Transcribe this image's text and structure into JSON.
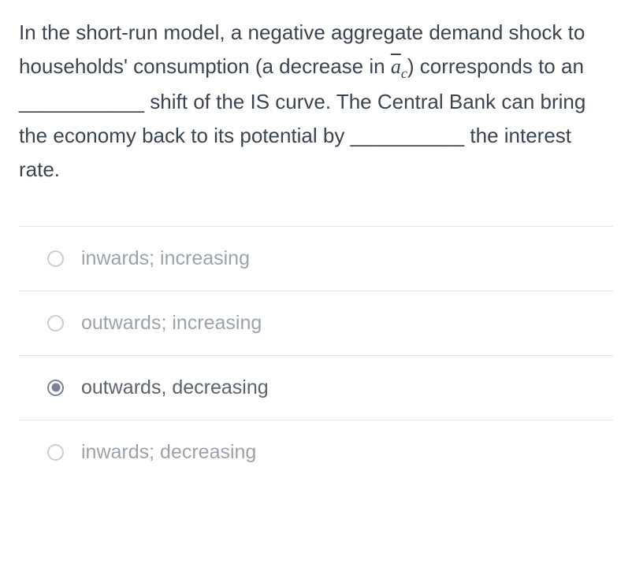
{
  "question": {
    "line1_prefix": "In the short-run model, a negative aggregate demand shock to households' consumption (a decrease in ",
    "variable_base": "a",
    "variable_sub": "c",
    "line1_suffix": ") corresponds to an ___________ shift of the IS curve. The Central Bank can bring the economy back to its potential by __________ the interest rate."
  },
  "options": [
    {
      "label": "inwards; increasing",
      "selected": false
    },
    {
      "label": "outwards; increasing",
      "selected": false
    },
    {
      "label": "outwards, decreasing",
      "selected": true
    },
    {
      "label": "inwards; decreasing",
      "selected": false
    }
  ]
}
